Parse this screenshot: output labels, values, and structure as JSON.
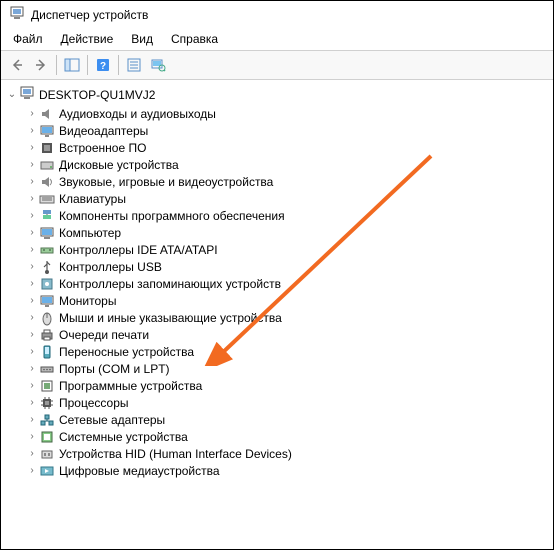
{
  "window": {
    "title": "Диспетчер устройств"
  },
  "menu": {
    "file": "Файл",
    "action": "Действие",
    "view": "Вид",
    "help": "Справка"
  },
  "tree": {
    "root": "DESKTOP-QU1MVJ2",
    "items": [
      {
        "label": "Аудиовходы и аудиовыходы",
        "icon": "audio"
      },
      {
        "label": "Видеоадаптеры",
        "icon": "display"
      },
      {
        "label": "Встроенное ПО",
        "icon": "firmware"
      },
      {
        "label": "Дисковые устройства",
        "icon": "disk"
      },
      {
        "label": "Звуковые, игровые и видеоустройства",
        "icon": "sound"
      },
      {
        "label": "Клавиатуры",
        "icon": "keyboard"
      },
      {
        "label": "Компоненты программного обеспечения",
        "icon": "software"
      },
      {
        "label": "Компьютер",
        "icon": "computer"
      },
      {
        "label": "Контроллеры IDE ATA/ATAPI",
        "icon": "ide"
      },
      {
        "label": "Контроллеры USB",
        "icon": "usb"
      },
      {
        "label": "Контроллеры запоминающих устройств",
        "icon": "storage"
      },
      {
        "label": "Мониторы",
        "icon": "monitor"
      },
      {
        "label": "Мыши и иные указывающие устройства",
        "icon": "mouse"
      },
      {
        "label": "Очереди печати",
        "icon": "printer"
      },
      {
        "label": "Переносные устройства",
        "icon": "portable"
      },
      {
        "label": "Порты (COM и LPT)",
        "icon": "port"
      },
      {
        "label": "Программные устройства",
        "icon": "swdev"
      },
      {
        "label": "Процессоры",
        "icon": "cpu"
      },
      {
        "label": "Сетевые адаптеры",
        "icon": "network"
      },
      {
        "label": "Системные устройства",
        "icon": "system"
      },
      {
        "label": "Устройства HID (Human Interface Devices)",
        "icon": "hid"
      },
      {
        "label": "Цифровые медиаустройства",
        "icon": "media"
      }
    ]
  }
}
